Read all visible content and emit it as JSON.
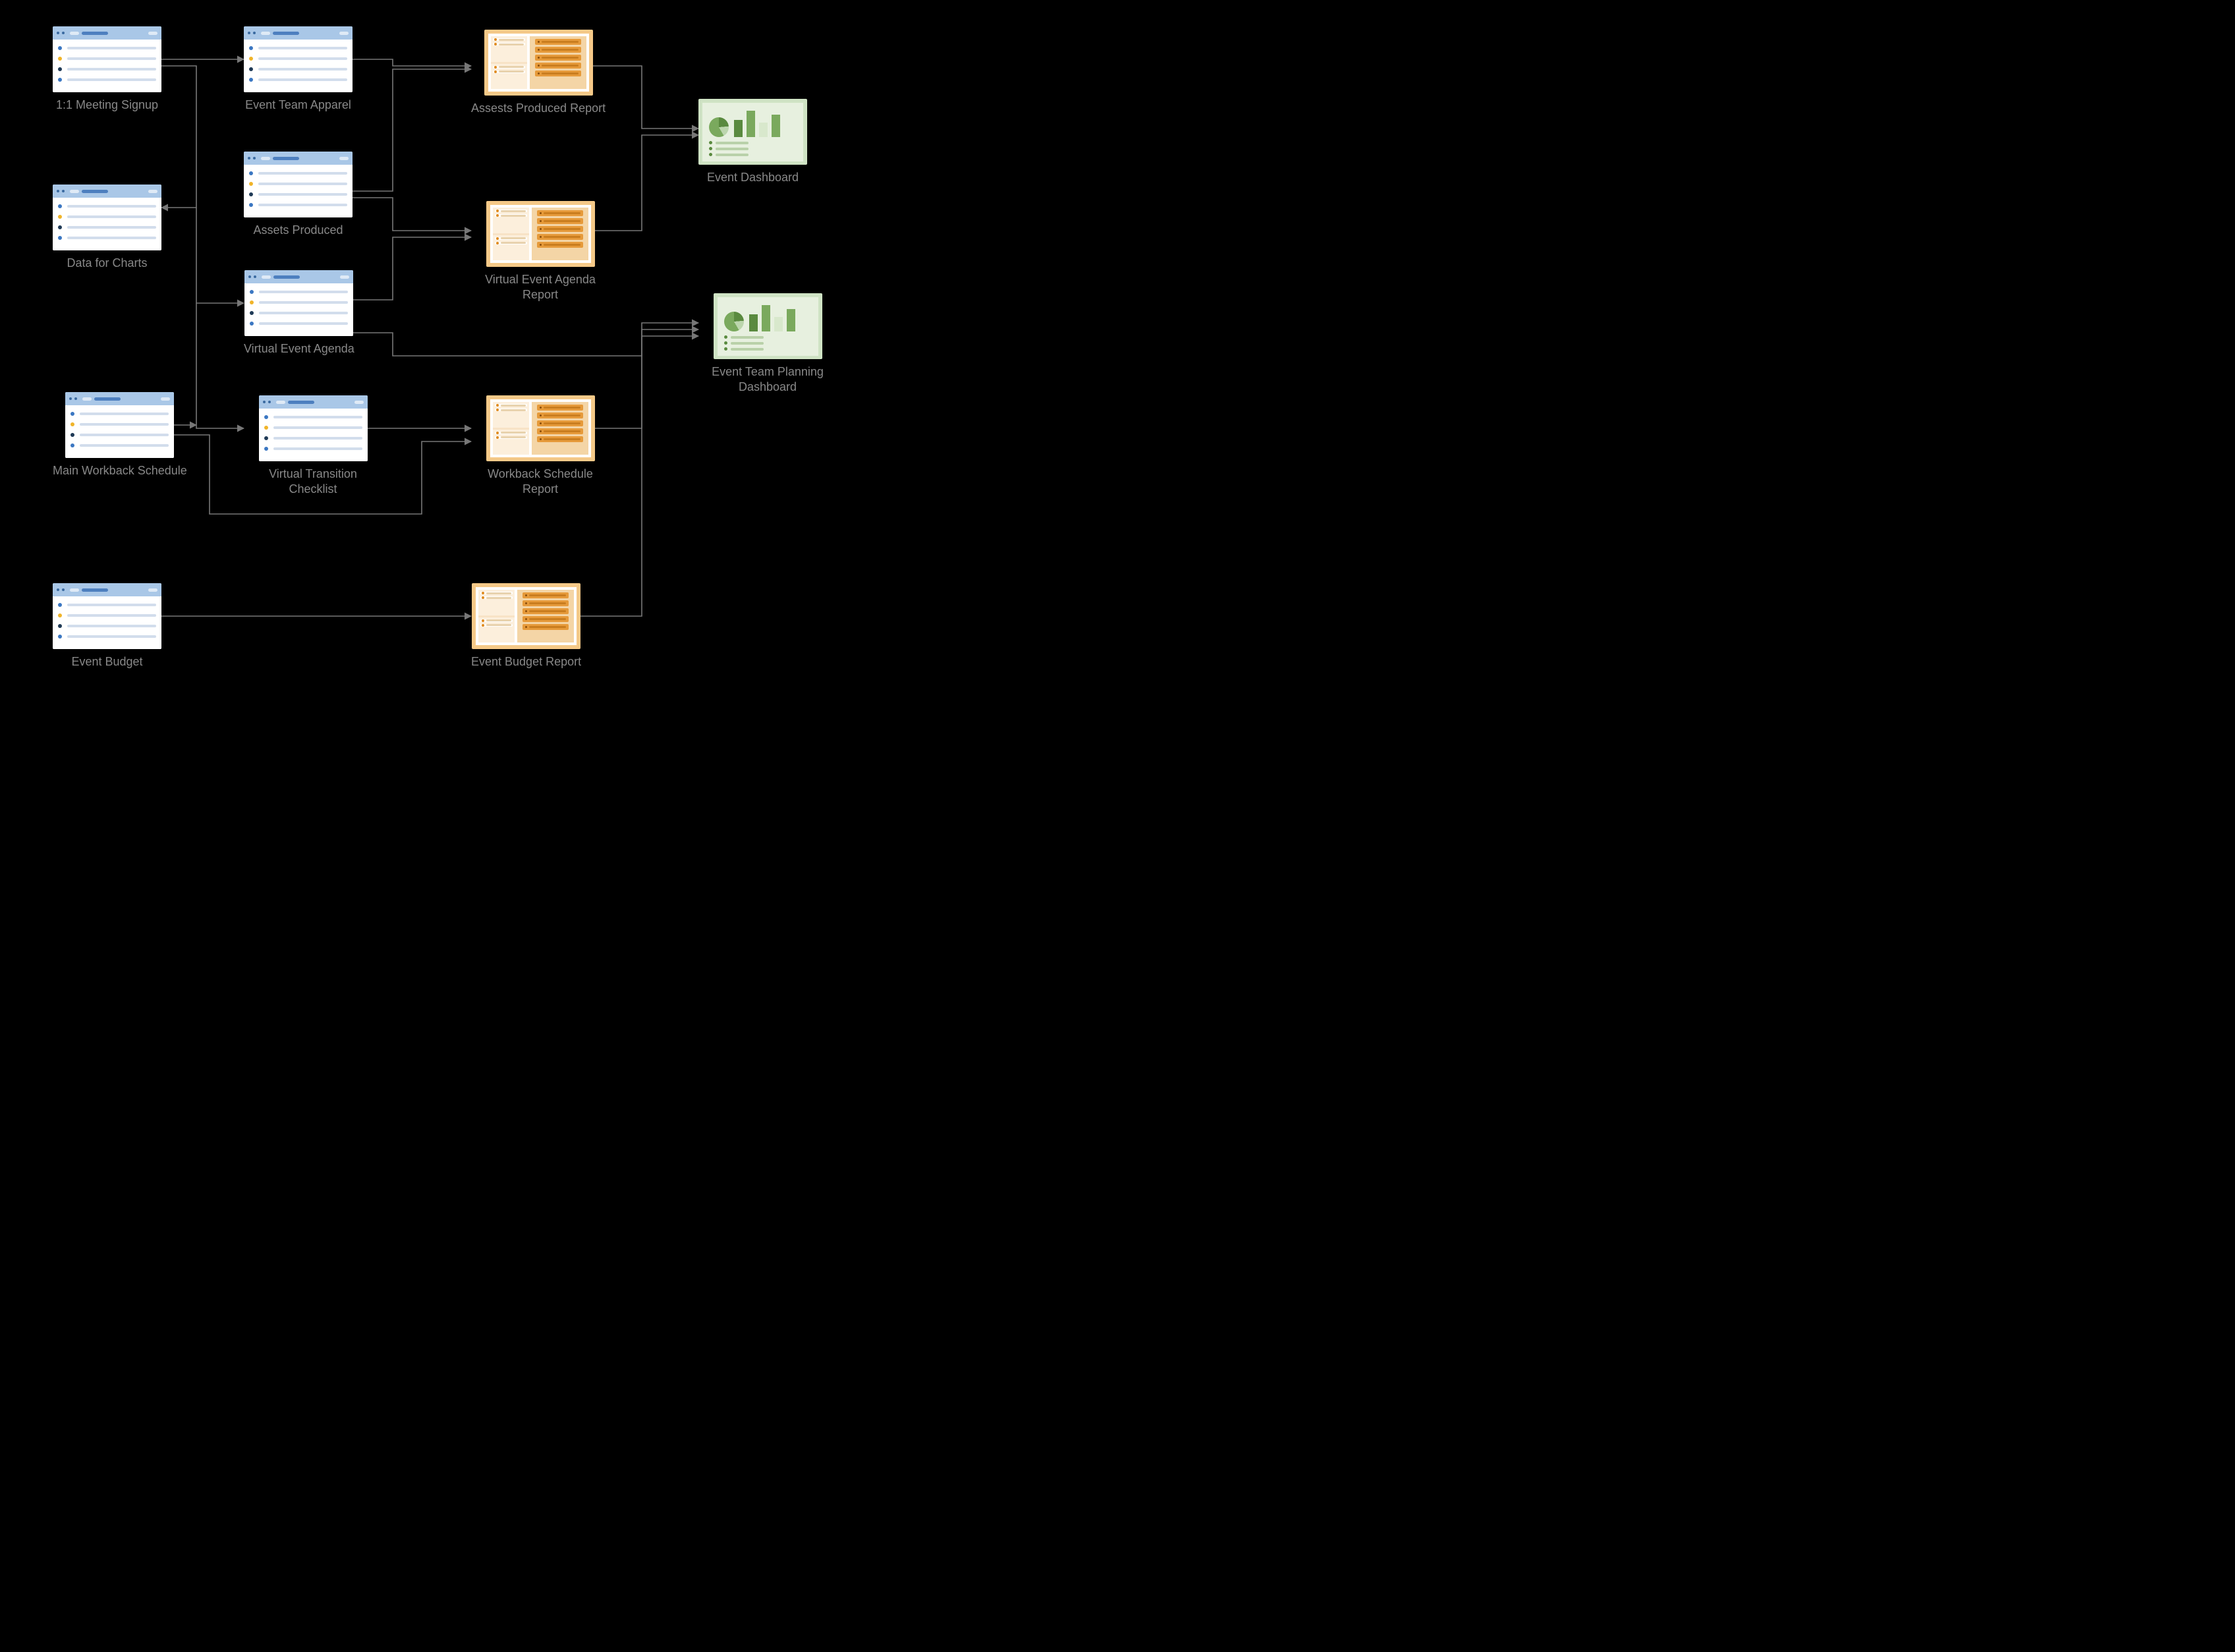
{
  "nodes": {
    "meeting": {
      "label": "1:1 Meeting Signup"
    },
    "apparel": {
      "label": "Event Team Apparel"
    },
    "assets_rpt": {
      "label": "Assests Produced Report"
    },
    "dash": {
      "label": "Event Dashboard"
    },
    "data_charts": {
      "label": "Data for Charts"
    },
    "assets": {
      "label": "Assets Produced"
    },
    "vea_rpt": {
      "label": "Virtual Event Agenda Report"
    },
    "team_dash": {
      "label": "Event Team Planning Dashboard"
    },
    "vea": {
      "label": "Virtual Event Agenda"
    },
    "workback": {
      "label": "Main Workback Schedule"
    },
    "vtc": {
      "label": "Virtual Transition Checklist"
    },
    "wb_rpt": {
      "label": "Workback Schedule Report"
    },
    "budget": {
      "label": "Event Budget"
    },
    "budget_rpt": {
      "label": "Event Budget Report"
    }
  }
}
